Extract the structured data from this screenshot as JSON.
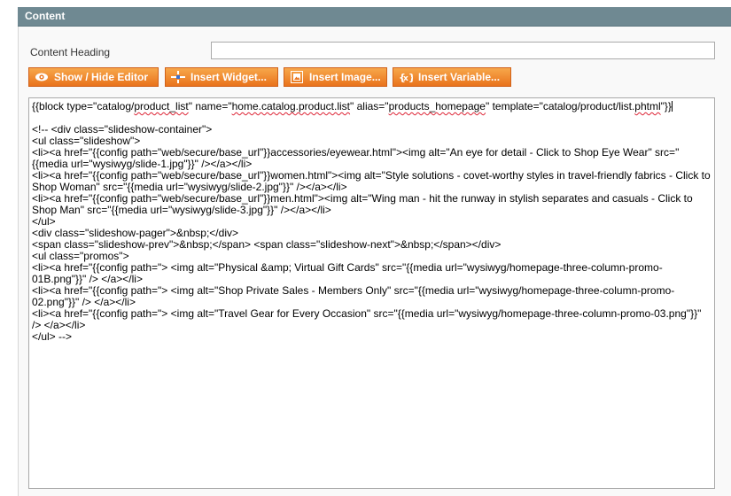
{
  "section": {
    "title": "Content"
  },
  "form": {
    "heading_label": "Content Heading",
    "heading_value": ""
  },
  "buttons": {
    "show_hide": "Show / Hide Editor",
    "insert_widget": "Insert Widget...",
    "insert_image": "Insert Image...",
    "insert_variable": "Insert Variable..."
  },
  "editor": {
    "first_line": {
      "p1": "{{block type=\"catalog/",
      "s1": "product_list",
      "p2": "\" name=\"",
      "s2": "home.catalog.product.list",
      "p3": "\" alias=\"",
      "s3": "products_homepage",
      "p4": "\" template=\"catalog/product/list.",
      "s4": "phtml",
      "p5": "\"}}"
    },
    "lines": [
      "<!-- <div class=\"slideshow-container\">",
      "<ul class=\"slideshow\">",
      "<li><a href=\"{{config path=\"web/secure/base_url\"}}accessories/eyewear.html\"><img alt=\"An eye for detail - Click to Shop Eye Wear\" src=\"{{media url=\"wysiwyg/slide-1.jpg\"}}\" /></a></li>",
      "<li><a href=\"{{config path=\"web/secure/base_url\"}}women.html\"><img alt=\"Style solutions - covet-worthy styles in travel-friendly fabrics - Click to Shop Woman\" src=\"{{media url=\"wysiwyg/slide-2.jpg\"}}\" /></a></li>",
      "<li><a href=\"{{config path=\"web/secure/base_url\"}}men.html\"><img alt=\"Wing man - hit the runway in stylish separates and casuals - Click to Shop Man\" src=\"{{media url=\"wysiwyg/slide-3.jpg\"}}\" /></a></li>",
      "</ul>",
      "<div class=\"slideshow-pager\">&nbsp;</div>",
      "<span class=\"slideshow-prev\">&nbsp;</span> <span class=\"slideshow-next\">&nbsp;</span></div>",
      "<ul class=\"promos\">",
      "<li><a href=\"{{config path=\"> <img alt=\"Physical &amp; Virtual Gift Cards\" src=\"{{media url=\"wysiwyg/homepage-three-column-promo-01B.png\"}}\" /> </a></li>",
      "<li><a href=\"{{config path=\"> <img alt=\"Shop Private Sales - Members Only\" src=\"{{media url=\"wysiwyg/homepage-three-column-promo-02.png\"}}\" /> </a></li>",
      "<li><a href=\"{{config path=\"> <img alt=\"Travel Gear for Every Occasion\" src=\"{{media url=\"wysiwyg/homepage-three-column-promo-03.png\"}}\" /> </a></li>",
      "</ul> -->"
    ]
  },
  "colors": {
    "header_bg": "#6f8992",
    "button_orange": "#e9731c"
  }
}
